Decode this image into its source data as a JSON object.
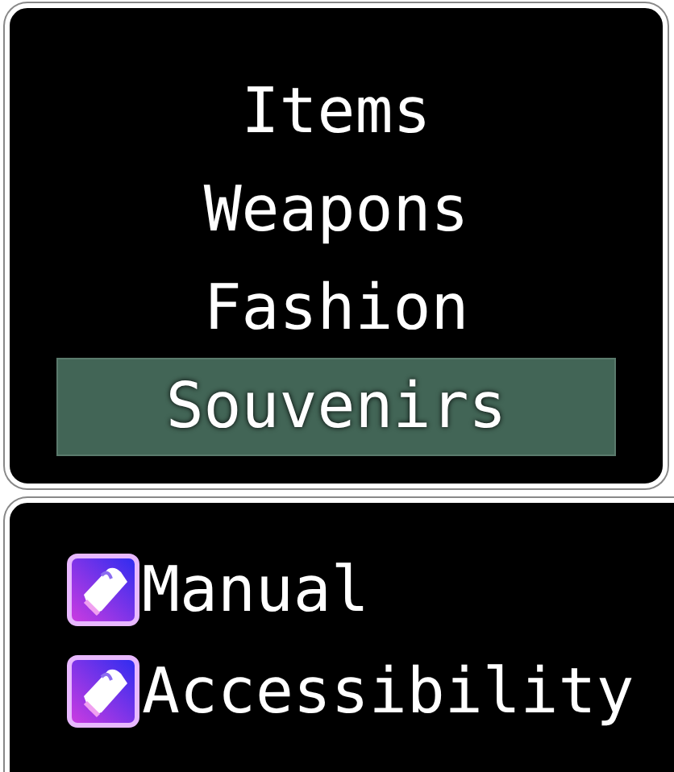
{
  "categories": [
    {
      "label": "Items",
      "selected": false
    },
    {
      "label": "Weapons",
      "selected": false
    },
    {
      "label": "Fashion",
      "selected": false
    },
    {
      "label": "Souvenirs",
      "selected": true
    }
  ],
  "items": [
    {
      "label": "Manual"
    },
    {
      "label": "Accessibility"
    }
  ]
}
